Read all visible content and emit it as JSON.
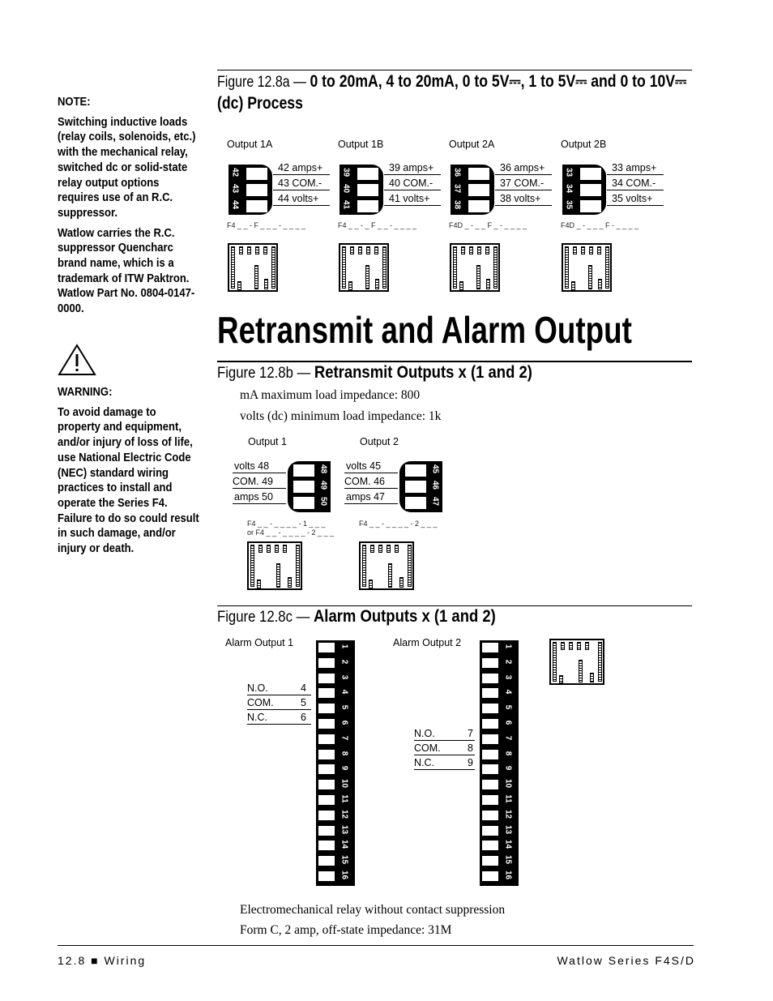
{
  "notes": {
    "note_heading": "NOTE:",
    "note_text": "Switching inductive loads (relay coils, solenoids, etc.) with the mechanical relay, switched dc or solid-state relay output options requires use of an R.C. suppressor.",
    "note_text2": "Watlow carries the R.C. suppressor Quencharc brand name, which is a trademark of ITW Paktron. Watlow Part No. 0804-0147-0000.",
    "warning_heading": "WARNING:",
    "warning_text": "To avoid damage to property and equipment, and/or injury of loss of life, use National Electric Code (NEC) standard wiring practices to install and operate the Series F4. Failure to do so could result in such damage, and/or injury or death."
  },
  "fig_a": {
    "label": "Figure 12.8a —",
    "title": "0 to 20mA, 4 to 20mA, 0 to 5V⎓, 1 to 5V⎓ and 0 to 10V⎓ (dc) Process",
    "outputs": [
      {
        "name": "Output 1A",
        "terms": [
          "42",
          "43",
          "44"
        ],
        "wires": [
          "42  amps+",
          "43 COM.-",
          "44  volts+"
        ],
        "code": "F4 _ _ - F _ _ _ - _ _ _ _"
      },
      {
        "name": "Output 1B",
        "terms": [
          "39",
          "40",
          "41"
        ],
        "wires": [
          "39  amps+",
          "40 COM.-",
          "41  volts+"
        ],
        "code": "F4 _ _ - _ F _ _ - _ _ _ _"
      },
      {
        "name": "Output 2A",
        "terms": [
          "36",
          "37",
          "38"
        ],
        "wires": [
          "36  amps+",
          "37 COM.-",
          "38  volts+"
        ],
        "code": "F4D _ - _ _ F _ - _ _ _ _"
      },
      {
        "name": "Output 2B",
        "terms": [
          "33",
          "34",
          "35"
        ],
        "wires": [
          "33  amps+",
          "34 COM.-",
          "35  volts+"
        ],
        "code": "F4D _ - _ _ _ F - _ _ _ _"
      }
    ]
  },
  "section_title": "Retransmit and Alarm Output",
  "fig_b": {
    "label": "Figure 12.8b —",
    "title": "Retransmit Outputs x (1 and 2)",
    "line1": "mA maximum load impedance: 800",
    "line2": "volts (dc) minimum load impedance: 1k",
    "outputs": [
      {
        "name": "Output 1",
        "terms": [
          "48",
          "49",
          "50"
        ],
        "wires": [
          "volts  48",
          "COM.  49",
          "amps  50"
        ],
        "code": "F4 _ _ - _ _ _ _ - 1 _ _ _",
        "code2": "or F4 _ _ - _ _ _ _ - 2 _ _ _"
      },
      {
        "name": "Output 2",
        "terms": [
          "45",
          "46",
          "47"
        ],
        "wires": [
          "volts  45",
          "COM.  46",
          "amps  47"
        ],
        "code": "F4 _ _ - _ _ _ _ - 2 _ _ _",
        "code2": ""
      }
    ]
  },
  "fig_c": {
    "label": "Figure 12.8c —",
    "title": "Alarm Outputs x (1 and 2)",
    "terminals": [
      "1",
      "2",
      "3",
      "4",
      "5",
      "6",
      "7",
      "8",
      "9",
      "10",
      "11",
      "12",
      "13",
      "14",
      "15",
      "16"
    ],
    "alarms": [
      {
        "name": "Alarm Output 1",
        "rows": [
          {
            "l": "N.O.",
            "n": "4"
          },
          {
            "l": "COM.",
            "n": "5"
          },
          {
            "l": "N.C.",
            "n": "6"
          }
        ]
      },
      {
        "name": "Alarm Output 2",
        "rows": [
          {
            "l": "N.O.",
            "n": "7"
          },
          {
            "l": "COM.",
            "n": "8"
          },
          {
            "l": "N.C.",
            "n": "9"
          }
        ]
      }
    ],
    "line1": "Electromechanical relay without contact suppression",
    "line2": "Form C, 2 amp, off-state impedance: 31M"
  },
  "footer": {
    "left": "12.8  ■  Wiring",
    "right": "Watlow Series F4S/D"
  }
}
